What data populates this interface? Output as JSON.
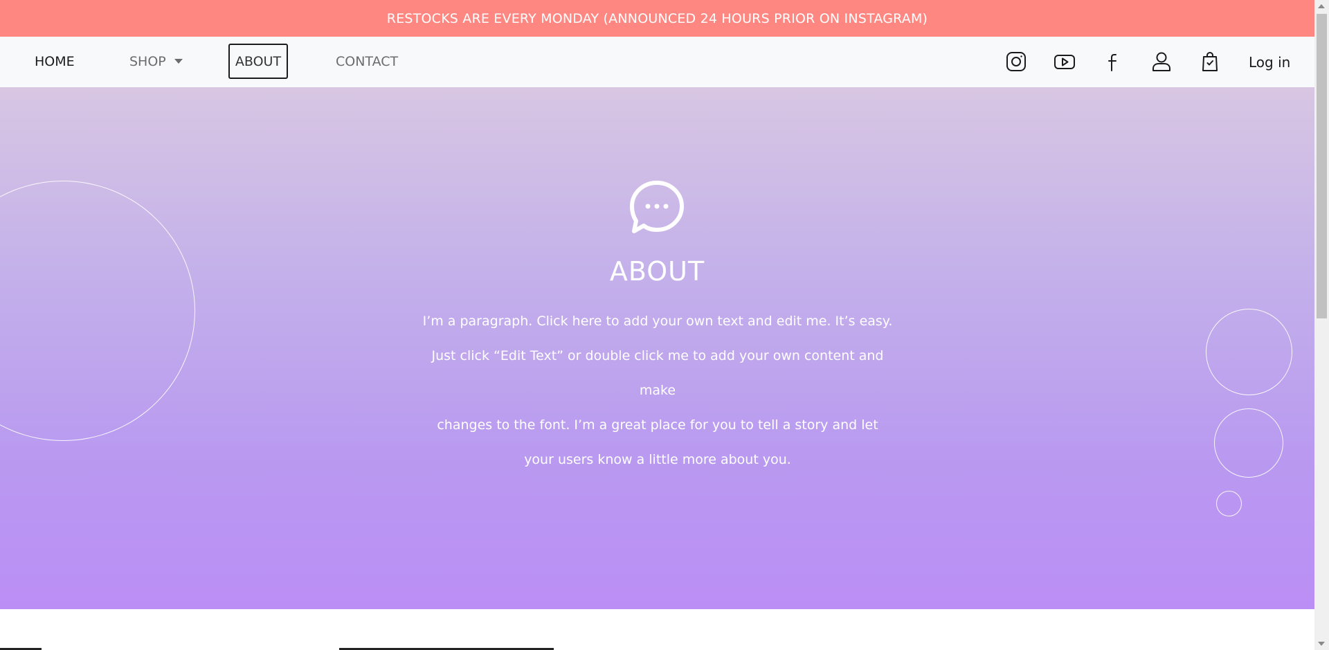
{
  "announcement": "RESTOCKS ARE EVERY MONDAY (ANNOUNCED 24 HOURS PRIOR ON INSTAGRAM)",
  "nav": {
    "home": "HOME",
    "shop": "SHOP",
    "about": "ABOUT",
    "contact": "CONTACT",
    "login": "Log in",
    "icons": [
      "instagram-icon",
      "youtube-icon",
      "facebook-icon",
      "user-icon",
      "shopping-bag-icon"
    ]
  },
  "hero": {
    "title": "ABOUT",
    "paragraph_lines": [
      "I’m a paragraph. Click here to add your own text and edit me. It’s easy.",
      "Just click “Edit Text” or double click me to add your own content and make",
      "changes to the font. I’m a great place for you to tell a story and let",
      "your users know a little more about you."
    ],
    "icon": "chat-bubble-icon"
  },
  "colors": {
    "announcement_bg": "#ff8782",
    "navbar_bg": "#f8f9fa",
    "hero_gradient_top": "#d8c6e3",
    "hero_gradient_bottom": "#bb8ef5"
  }
}
